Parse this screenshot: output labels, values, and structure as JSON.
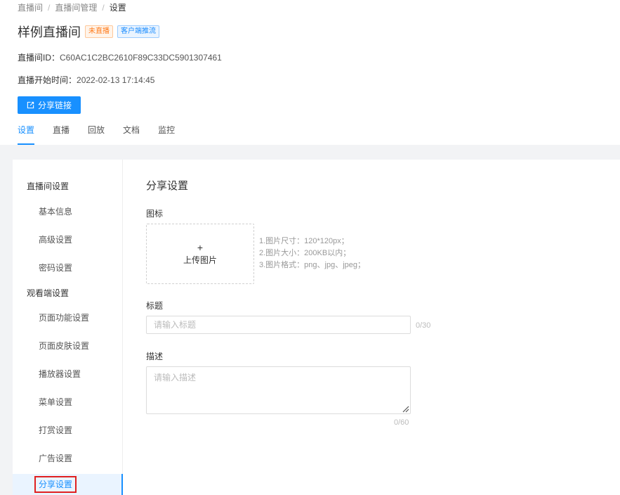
{
  "breadcrumb": {
    "item1": "直播间",
    "item2": "直播间管理",
    "current": "设置",
    "separator": "/"
  },
  "page": {
    "title": "样例直播间",
    "status_tag": "未直播",
    "push_tag": "客户端推流",
    "id_label": "直播间ID：",
    "id_value": "C60AC1C2BC2610F89C33DC5901307461",
    "start_label": "直播开始时间：",
    "start_value": "2022-02-13 17:14:45",
    "share_button": "分享链接"
  },
  "tabs": [
    {
      "label": "设置",
      "active": true
    },
    {
      "label": "直播"
    },
    {
      "label": "回放"
    },
    {
      "label": "文档"
    },
    {
      "label": "监控"
    }
  ],
  "sidenav": {
    "group1": "直播间设置",
    "group1_items": [
      "基本信息",
      "高级设置",
      "密码设置"
    ],
    "group2": "观看端设置",
    "group2_items": [
      "页面功能设置",
      "页面皮肤设置",
      "播放器设置",
      "菜单设置",
      "打赏设置",
      "广告设置",
      "分享设置"
    ],
    "active_item": "分享设置"
  },
  "form": {
    "section_title": "分享设置",
    "icon_label": "图标",
    "upload_plus": "+",
    "upload_text": "上传图片",
    "hints": [
      "1.图片尺寸：120*120px；",
      "2.图片大小：200KB以内；",
      "3.图片格式：png、jpg、jpeg；"
    ],
    "title_label": "标题",
    "title_placeholder": "请输入标题",
    "title_counter": "0/30",
    "desc_label": "描述",
    "desc_placeholder": "请输入描述",
    "desc_counter": "0/60"
  },
  "colors": {
    "primary": "#1890ff",
    "status_orange": "#ff7a1a",
    "page_bg": "#f2f3f5",
    "highlight_red": "#e02020"
  },
  "icons": {
    "share_button_icon": "external-link-icon",
    "upload_icon": "plus-icon",
    "resize_icon": "resize-grip-icon"
  }
}
